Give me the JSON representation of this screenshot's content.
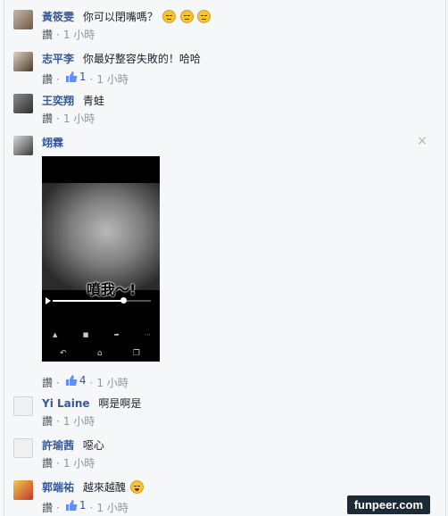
{
  "comments": [
    {
      "author": "黃筱雯",
      "text": "你可以閉嘴嗎？",
      "emoji_count": 3,
      "like": "讚",
      "time": "1 小時",
      "likes": ""
    },
    {
      "author": "志平李",
      "text": "你最好整容失敗的！哈哈",
      "like": "讚",
      "likes": "1",
      "time": "1 小時"
    },
    {
      "author": "王奕翔",
      "text": "青蛙",
      "like": "讚",
      "time": "1 小時",
      "likes": ""
    },
    {
      "author": "翊霖",
      "text": "",
      "like": "讚",
      "likes": "4",
      "time": "1 小時"
    },
    {
      "author": "Yi Laine",
      "text": "啊是啊是",
      "like": "讚",
      "time": "1 小時",
      "likes": ""
    },
    {
      "author": "許瑜茜",
      "text": "噁心",
      "like": "讚",
      "time": "1 小時",
      "likes": ""
    },
    {
      "author": "郭端祐",
      "text": "越來越醜",
      "like": "讚",
      "likes": "1",
      "time": "1 小時"
    }
  ],
  "video": {
    "caption": "噴我～!",
    "progress": 0.72
  },
  "close_glyph": "×",
  "dot": "·",
  "watermark": "funpeer.com",
  "colors": {
    "author": "#365899",
    "meta": "#90949c",
    "background": "#f6f7f9"
  }
}
